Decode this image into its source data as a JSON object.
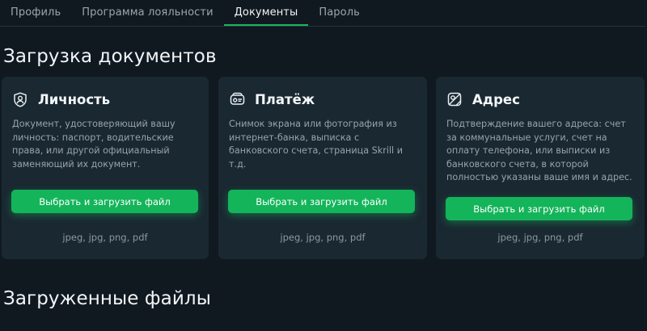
{
  "tabs": [
    {
      "label": "Профиль",
      "active": false
    },
    {
      "label": "Программа лояльности",
      "active": false
    },
    {
      "label": "Документы",
      "active": true
    },
    {
      "label": "Пароль",
      "active": false
    }
  ],
  "section_upload_title": "Загрузка документов",
  "section_uploaded_title": "Загруженные файлы",
  "cards": [
    {
      "icon": "user-shield-icon",
      "title": "Личность",
      "description": "Документ, удостоверяющий вашу личность: паспорт, водительские права, или другой официальный заменяющий их документ.",
      "button_label": "Выбрать и загрузить файл",
      "formats": "jpeg, jpg, png, pdf"
    },
    {
      "icon": "payment-card-icon",
      "title": "Платёж",
      "description": "Снимок экрана или фотография из интернет-банка, выписка с банковского счета, страница Skrill и т.д.",
      "button_label": "Выбрать и загрузить файл",
      "formats": "jpeg, jpg, png, pdf"
    },
    {
      "icon": "address-map-icon",
      "title": "Адрес",
      "description": "Подтверждение вашего адреса: счет за коммунальные услуги, счет на оплату телефона, или выписки из банковского счета, в которой полностью указаны ваше имя и адрес.",
      "button_label": "Выбрать и загрузить файл",
      "formats": "jpeg, jpg, png, pdf"
    }
  ],
  "colors": {
    "background": "#101920",
    "card": "#1a2831",
    "accent": "#14b45a"
  }
}
